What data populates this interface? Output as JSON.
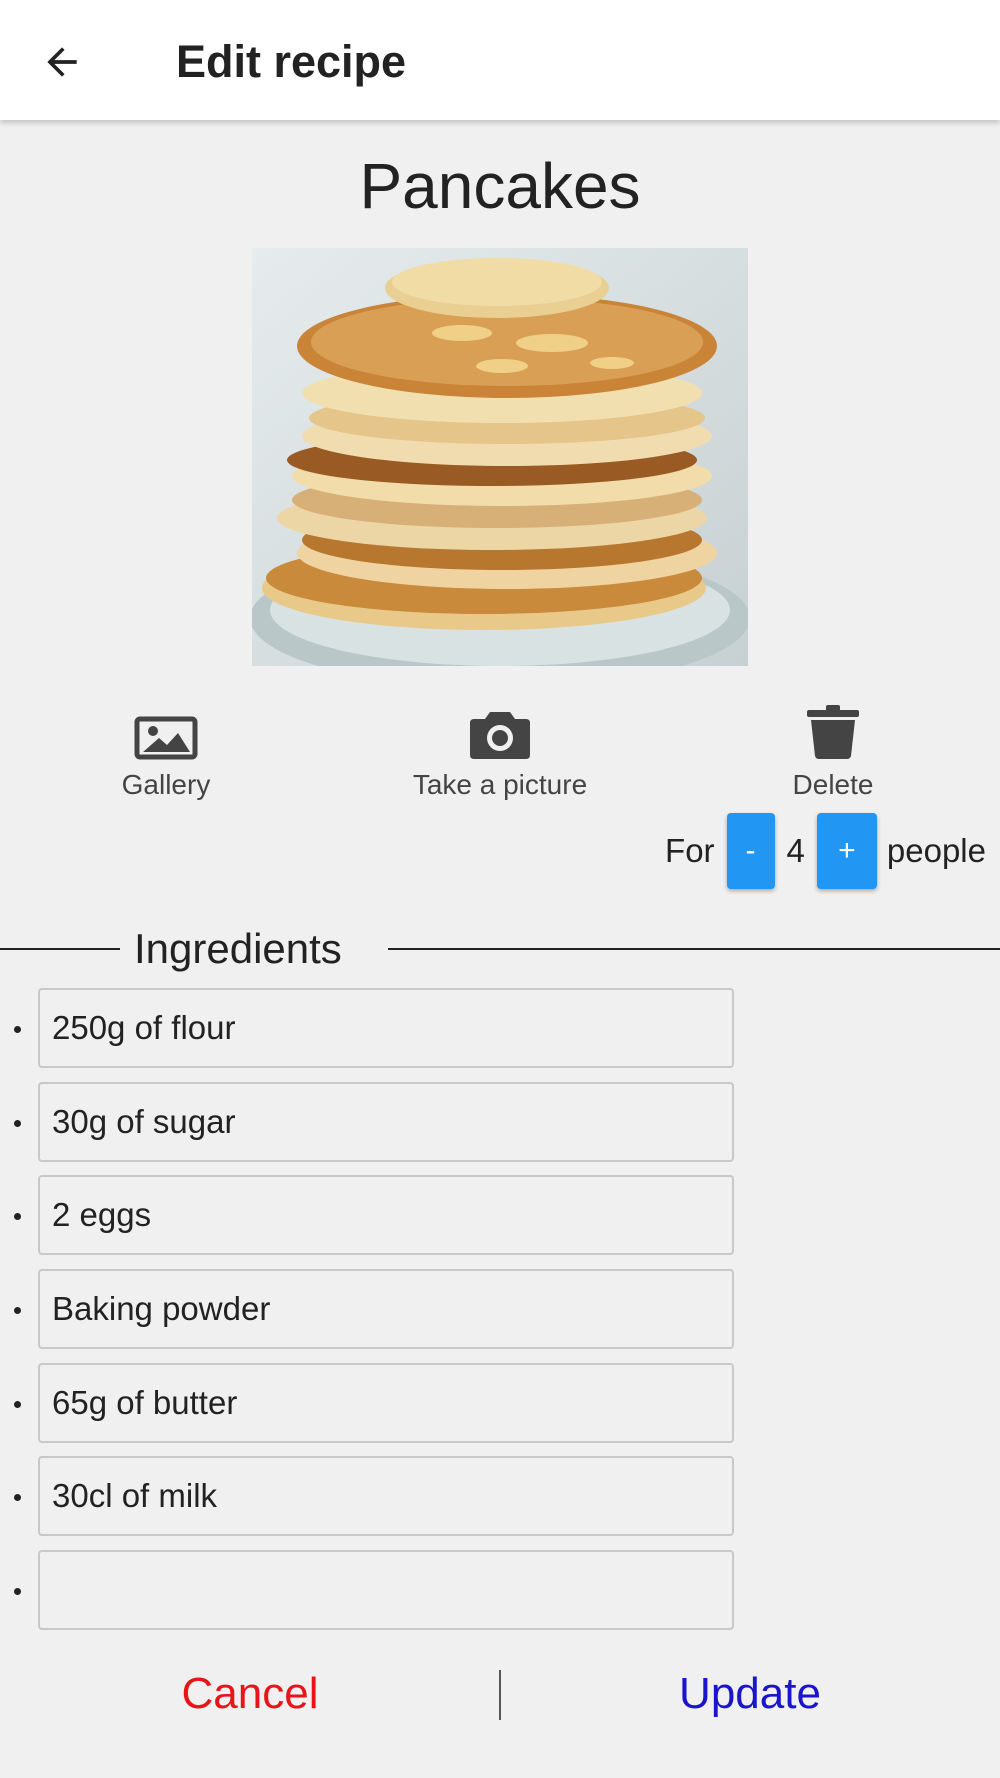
{
  "appbar": {
    "back_icon": "arrow-left-icon",
    "title": "Edit recipe"
  },
  "recipe": {
    "name": "Pancakes",
    "photo": "stack-of-pancakes-photo"
  },
  "actions": {
    "gallery": {
      "icon": "image-icon",
      "label": "Gallery"
    },
    "camera": {
      "icon": "camera-icon",
      "label": "Take a picture"
    },
    "delete": {
      "icon": "trash-icon",
      "label": "Delete"
    }
  },
  "servings": {
    "prefix": "For",
    "minus_label": "-",
    "count": "4",
    "plus_label": "+",
    "suffix": "people",
    "button_color": "#2196f3"
  },
  "ingredients": {
    "heading": "Ingredients",
    "items": [
      {
        "value": "250g of flour"
      },
      {
        "value": "30g of sugar"
      },
      {
        "value": "2 eggs"
      },
      {
        "value": "Baking powder"
      },
      {
        "value": "65g of butter"
      },
      {
        "value": "30cl of milk"
      },
      {
        "value": ""
      }
    ]
  },
  "footer": {
    "cancel_label": "Cancel",
    "update_label": "Update",
    "cancel_color": "#e8141a",
    "update_color": "#1a14cc"
  }
}
